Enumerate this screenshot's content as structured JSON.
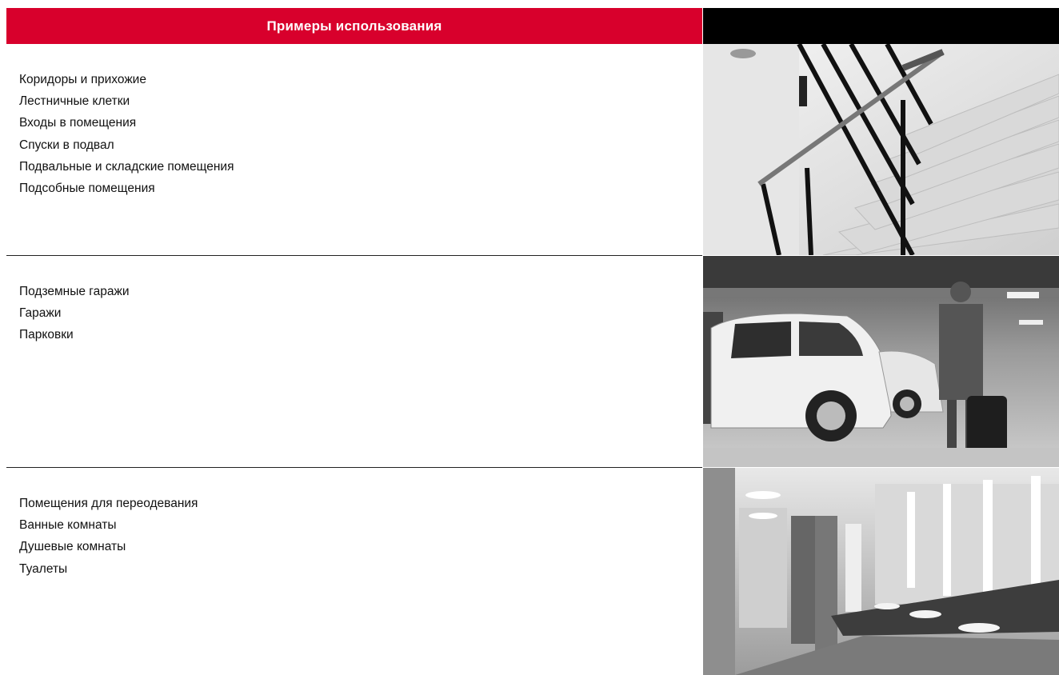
{
  "header": {
    "title": "Примеры использования"
  },
  "sections": [
    {
      "items": [
        "Коридоры и прихожие",
        "Лестничные клетки",
        "Входы в помещения",
        "Спуски в подвал",
        "Подвальные и складские помещения",
        "Подсобные помещения"
      ],
      "photo": "staircase-photo"
    },
    {
      "items": [
        "Подземные гаражи",
        "Гаражи",
        "Парковки"
      ],
      "photo": "parking-garage-photo"
    },
    {
      "items": [
        "Помещения для переодевания",
        "Ванные комнаты",
        "Душевые комнаты",
        "Туалеты"
      ],
      "photo": "restroom-photo"
    }
  ],
  "colors": {
    "accent": "#d8002c",
    "header_right": "#000000",
    "text": "#111111"
  }
}
